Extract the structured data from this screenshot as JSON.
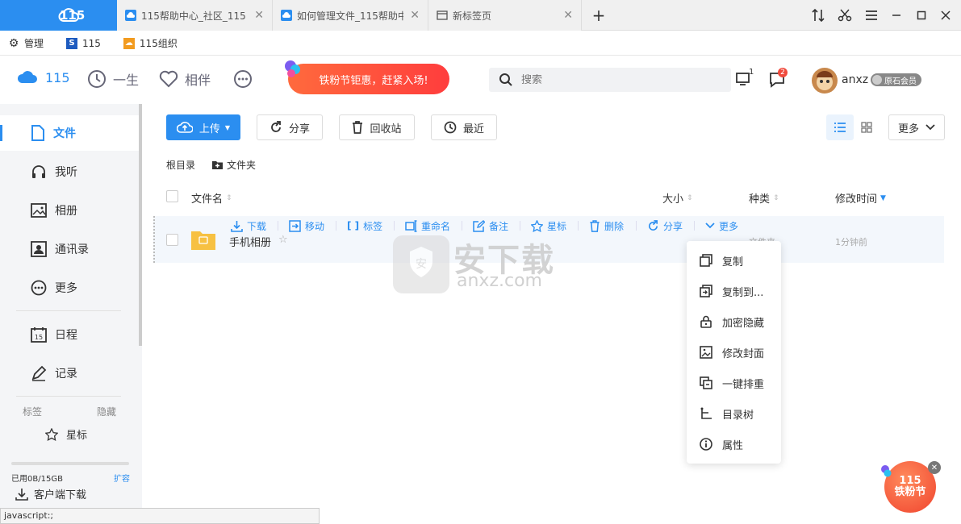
{
  "browser": {
    "brand": "115",
    "tabs": [
      {
        "title": "115帮助中心_社区_115"
      },
      {
        "title": "如何管理文件_115帮助中"
      },
      {
        "title": "新标签页"
      }
    ]
  },
  "bookmarks": [
    {
      "label": "管理"
    },
    {
      "label": "115"
    },
    {
      "label": "115组织"
    }
  ],
  "header": {
    "nav": [
      {
        "label": "115"
      },
      {
        "label": "一生"
      },
      {
        "label": "相伴"
      }
    ],
    "promo": "铁粉节钜惠，赶紧入场!",
    "search_placeholder": "搜索",
    "device_badge": "1",
    "msg_badge": "2",
    "username": "anxz",
    "member": "原石会员"
  },
  "sidebar": {
    "items": [
      {
        "label": "文件"
      },
      {
        "label": "我听"
      },
      {
        "label": "相册"
      },
      {
        "label": "通讯录"
      },
      {
        "label": "更多"
      },
      {
        "label": "日程"
      },
      {
        "label": "记录"
      }
    ],
    "tags_label": "标签",
    "hide_label": "隐藏",
    "star_label": "星标",
    "storage": "已用0B/15GB",
    "expand": "扩容",
    "download": "客户端下载"
  },
  "toolbar": {
    "upload": "上传",
    "share": "分享",
    "recycle": "回收站",
    "recent": "最近",
    "more": "更多"
  },
  "breadcrumb": {
    "root": "根目录",
    "new_folder": "文件夹"
  },
  "table": {
    "headers": {
      "name": "文件名",
      "size": "大小",
      "type": "种类",
      "modified": "修改时间"
    },
    "rows": [
      {
        "name": "手机相册",
        "type": "文件夹",
        "modified": "1分钟前"
      }
    ]
  },
  "row_actions": [
    {
      "label": "下载"
    },
    {
      "label": "移动"
    },
    {
      "label": "标签"
    },
    {
      "label": "重命名"
    },
    {
      "label": "备注"
    },
    {
      "label": "星标"
    },
    {
      "label": "删除"
    },
    {
      "label": "分享"
    },
    {
      "label": "更多"
    }
  ],
  "more_menu": [
    {
      "label": "复制"
    },
    {
      "label": "复制到..."
    },
    {
      "label": "加密隐藏"
    },
    {
      "label": "修改封面"
    },
    {
      "label": "一键排重"
    },
    {
      "label": "目录树"
    },
    {
      "label": "属性"
    }
  ],
  "status_url": "javascript:;",
  "float_badge": {
    "line1": "115",
    "line2": "铁粉节"
  },
  "watermark": {
    "cn": "安下载",
    "en": "anxz.com"
  },
  "colors": {
    "accent": "#2b8ef0",
    "promo": "#ff4d3d",
    "sidebar_bg": "#f4f5f7"
  }
}
